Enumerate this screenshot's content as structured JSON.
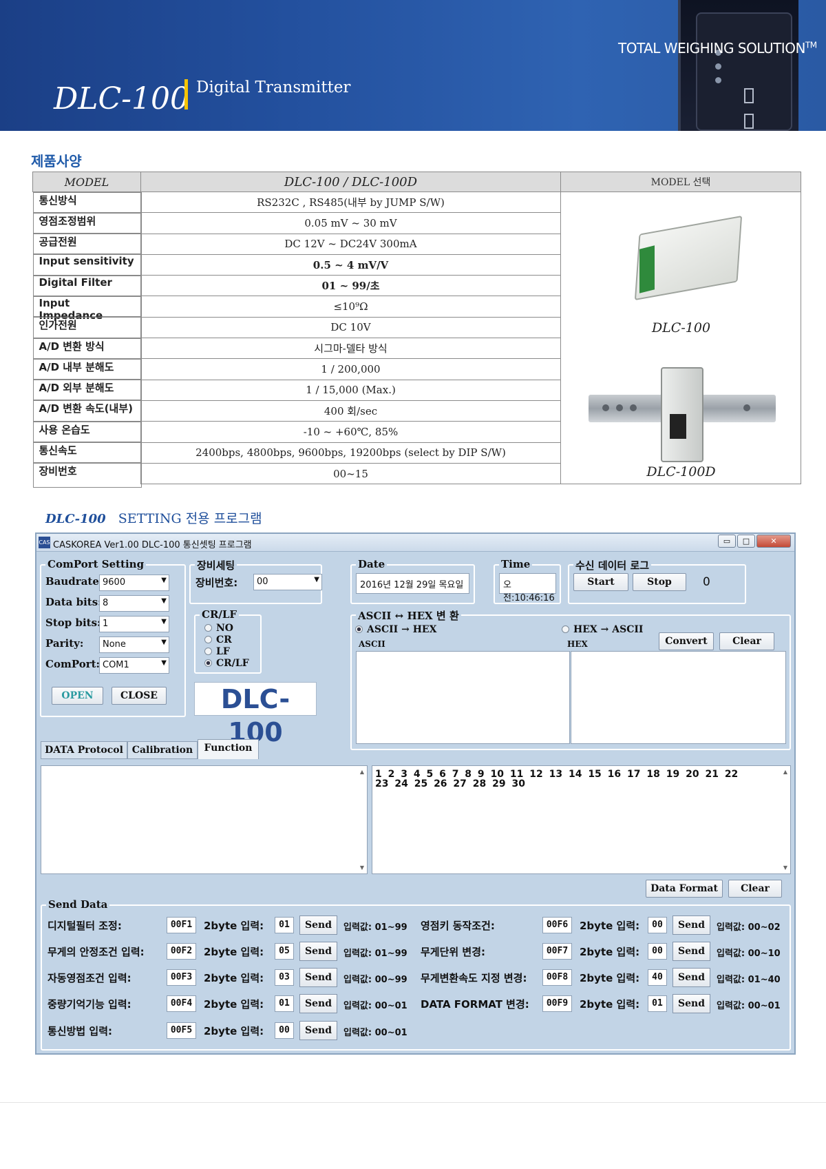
{
  "header": {
    "tagline": "TOTAL WEIGHING SOLUTION",
    "tagline_tm": "TM",
    "model": "DLC-100",
    "subtitle": "Digital Transmitter",
    "colors": {
      "banner": "#23509e",
      "accent_bar": "#f5c400"
    }
  },
  "spec": {
    "section_title": "제품사양",
    "head_model": "MODEL",
    "head_name": "DLC-100 / DLC-100D",
    "head_select": "MODEL 선택",
    "rows": [
      {
        "label": "통신방식",
        "value": "RS232C , RS485(내부 by JUMP S/W)"
      },
      {
        "label": "영점조정범위",
        "value": "0.05 mV ~ 30 mV"
      },
      {
        "label": "공급전원",
        "value": "DC 12V ~ DC24V 300mA"
      },
      {
        "label": "Input sensitivity",
        "value": "0.5 ~ 4 mV/V"
      },
      {
        "label": "Digital Filter",
        "value": "01 ~ 99/초"
      },
      {
        "label": "Input Impedance",
        "value": "≤10⁹Ω"
      },
      {
        "label": "인가전원",
        "value": "DC 10V"
      },
      {
        "label": "A/D 변환 방식",
        "value": "시그마-델타 방식"
      },
      {
        "label": "A/D 내부 분해도",
        "value": "1 / 200,000"
      },
      {
        "label": "A/D 외부 분해도",
        "value": "1 / 15,000 (Max.)"
      },
      {
        "label": "A/D 변환 속도(내부)",
        "value": "400 회/sec"
      },
      {
        "label": "사용 온습도",
        "value": "-10 ~ +60℃, 85%"
      },
      {
        "label": "통신속도",
        "value": "2400bps, 4800bps, 9600bps, 19200bps (select by DIP S/W)"
      },
      {
        "label": "장비번호",
        "value": "00~15"
      }
    ],
    "image_captions": [
      "DLC-100",
      "DLC-100D"
    ]
  },
  "program": {
    "heading_model": "DLC-100",
    "heading_text": "SETTING 전용 프로그램"
  },
  "app": {
    "window_title": "CASKOREA Ver1.00 DLC-100 통신셋팅 프로그램",
    "icon_text": "CAS",
    "win_buttons": {
      "minimize": "▭",
      "maximize": "□",
      "close": "✕"
    },
    "comport": {
      "title": "ComPort Setting",
      "baudrate_label": "Baudrate:",
      "baudrate": "9600",
      "databits_label": "Data bits:",
      "databits": "8",
      "stopbits_label": "Stop bits:",
      "stopbits": "1",
      "parity_label": "Parity:",
      "parity": "None",
      "port_label": "ComPort:",
      "port": "COM1",
      "open": "OPEN",
      "close": "CLOSE"
    },
    "device": {
      "title": "장비세팅",
      "number_label": "장비번호:",
      "number": "00"
    },
    "crlf": {
      "title": "CR/LF",
      "options": [
        "NO",
        "CR",
        "LF",
        "CR/LF"
      ],
      "selected": "CR/LF"
    },
    "logo": "DLC-100",
    "date": {
      "title": "Date",
      "value": "2016년 12월 29일 목요일"
    },
    "time": {
      "title": "Time",
      "value": "오전:10:46:16"
    },
    "log": {
      "title": "수신 데이터 로그",
      "start": "Start",
      "stop": "Stop",
      "count": "0"
    },
    "convert": {
      "title": "ASCII ↔ HEX 변 환",
      "opt1": "ASCII → HEX",
      "opt2": "HEX → ASCII",
      "selected": "ASCII → HEX",
      "col1": "ASCII",
      "col2": "HEX",
      "convert_btn": "Convert",
      "clear_btn": "Clear"
    },
    "tabs": [
      "DATA Protocol",
      "Calibration",
      "Function"
    ],
    "active_tab": "Function",
    "day_numbers": "1 2 3 4 5 6 7 8 9 10 11 12 13 14 15 16 17 18 19 20 21 22 23 24 25 26 27 28 29 30",
    "data_format_btn": "Data Format",
    "clear_btn": "Clear",
    "send": {
      "title": "Send Data",
      "byte_label": "2byte 입력:",
      "send_label": "Send",
      "left": [
        {
          "label": "디지털필터 조정:",
          "code": "00F1",
          "input": "01",
          "range": "입력값: 01~99"
        },
        {
          "label": "무게의 안정조건 입력:",
          "code": "00F2",
          "input": "05",
          "range": "입력값: 01~99"
        },
        {
          "label": "자동영점조건 입력:",
          "code": "00F3",
          "input": "03",
          "range": "입력값: 00~99"
        },
        {
          "label": "중량기억기능 입력:",
          "code": "00F4",
          "input": "01",
          "range": "입력값: 00~01"
        },
        {
          "label": "통신방법 입력:",
          "code": "00F5",
          "input": "00",
          "range": "입력값: 00~01"
        }
      ],
      "right": [
        {
          "label": "영점키 동작조건:",
          "code": "00F6",
          "input": "00",
          "range": "입력값: 00~02"
        },
        {
          "label": "무게단위 변경:",
          "code": "00F7",
          "input": "00",
          "range": "입력값: 00~10"
        },
        {
          "label": "무게변환속도 지정 변경:",
          "code": "00F8",
          "input": "40",
          "range": "입력값: 01~40"
        },
        {
          "label": "DATA FORMAT 변경:",
          "code": "00F9",
          "input": "01",
          "range": "입력값: 00~01"
        }
      ]
    }
  }
}
